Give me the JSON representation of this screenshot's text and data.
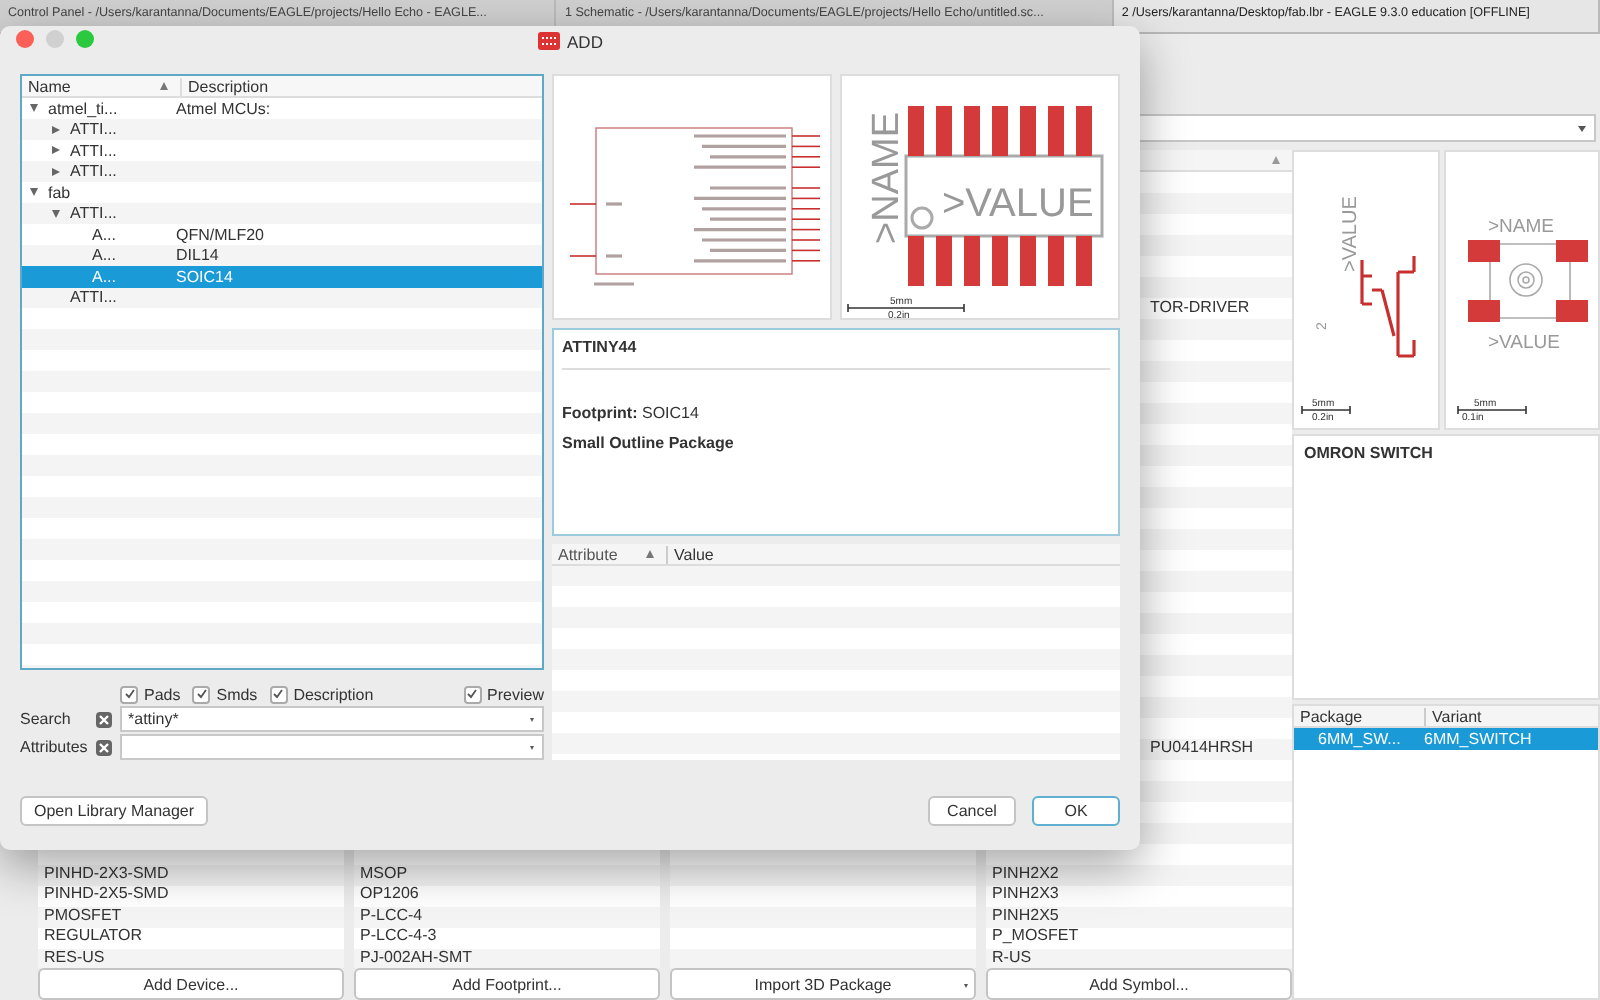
{
  "tabs": [
    {
      "title": "Control Panel - /Users/karantanna/Documents/EAGLE/projects/Hello Echo - EAGLE...",
      "selected": false
    },
    {
      "title": "1 Schematic - /Users/karantanna/Documents/EAGLE/projects/Hello Echo/untitled.sc...",
      "selected": false
    },
    {
      "title": "2 /Users/karantanna/Desktop/fab.lbr - EAGLE 9.3.0 education [OFFLINE]",
      "selected": true
    }
  ],
  "library": {
    "columns": [
      {
        "items": [
          "PINHD-2X3-SMD",
          "PINHD-2X5-SMD",
          "PMOSFET",
          "REGULATOR",
          "RES-US"
        ],
        "button": {
          "label": "Add Device...",
          "kind": "plain"
        }
      },
      {
        "items": [
          "MSOP",
          "OP1206",
          "P-LCC-4",
          "P-LCC-4-3",
          "PJ-002AH-SMT"
        ],
        "button": {
          "label": "Add Footprint...",
          "kind": "plain"
        }
      },
      {
        "button": {
          "label": "Import 3D Package",
          "kind": "menu"
        }
      },
      {
        "peek_items": [
          "TOR-DRIVER",
          "PU0414HRSH"
        ],
        "items": [
          "PINH2X2",
          "PINH2X3",
          "PINH2X5",
          "P_MOSFET",
          "R-US"
        ],
        "button": {
          "label": "Add Symbol...",
          "kind": "plain"
        }
      }
    ],
    "symbol_preview": {
      "value_label": ">VALUE",
      "pin_label": "2",
      "scale": [
        "5mm",
        "0.2in"
      ]
    },
    "package_preview": {
      "name_label": ">NAME",
      "value_label": ">VALUE",
      "scale": [
        "5mm",
        "0.1in"
      ]
    },
    "description": {
      "title": "OMRON SWITCH"
    },
    "variants": {
      "columns": [
        "Package",
        "Variant"
      ],
      "rows": [
        {
          "cells": [
            "6MM_SW...",
            "6MM_SWITCH"
          ],
          "selected": true
        }
      ]
    }
  },
  "dialog": {
    "title": "ADD",
    "tree": {
      "columns": [
        "Name",
        "Description"
      ],
      "nodes": [
        {
          "name": "atmel_ti...",
          "description": "Atmel MCUs:",
          "expanded": true,
          "selected": false,
          "children": [
            {
              "name": "ATTI...",
              "expanded": false,
              "selected": false
            },
            {
              "name": "ATTI...",
              "expanded": false,
              "selected": false
            },
            {
              "name": "ATTI...",
              "expanded": false,
              "selected": false
            }
          ]
        },
        {
          "name": "fab",
          "expanded": true,
          "selected": false,
          "children": [
            {
              "name": "ATTI...",
              "expanded": true,
              "selected": false,
              "children": [
                {
                  "name": "A...",
                  "description": "QFN/MLF20",
                  "selected": false
                },
                {
                  "name": "A...",
                  "description": "DIL14",
                  "selected": false
                },
                {
                  "name": "A...",
                  "description": "SOIC14",
                  "selected": true
                }
              ]
            },
            {
              "name": "ATTI...",
              "selected": false
            }
          ]
        }
      ]
    },
    "filters": [
      {
        "label": "Pads",
        "checked": true
      },
      {
        "label": "Smds",
        "checked": true
      },
      {
        "label": "Description",
        "checked": true
      }
    ],
    "preview_toggle": {
      "label": "Preview",
      "checked": true
    },
    "search": {
      "label": "Search",
      "value": "*attiny*"
    },
    "attributes": {
      "label": "Attributes"
    },
    "package_preview": {
      "name_label": ">NAME",
      "value_label": ">VALUE",
      "scale": [
        "5mm",
        "0.2in"
      ]
    },
    "description": {
      "title": "ATTINY44",
      "footprint": "**Footprint:** SOIC14",
      "package": "Small Outline Package"
    },
    "attribute_table": {
      "columns": [
        "Attribute",
        "Value"
      ]
    },
    "buttons": {
      "library_manager": "Open Library Manager",
      "cancel": "Cancel",
      "ok": "OK"
    }
  }
}
